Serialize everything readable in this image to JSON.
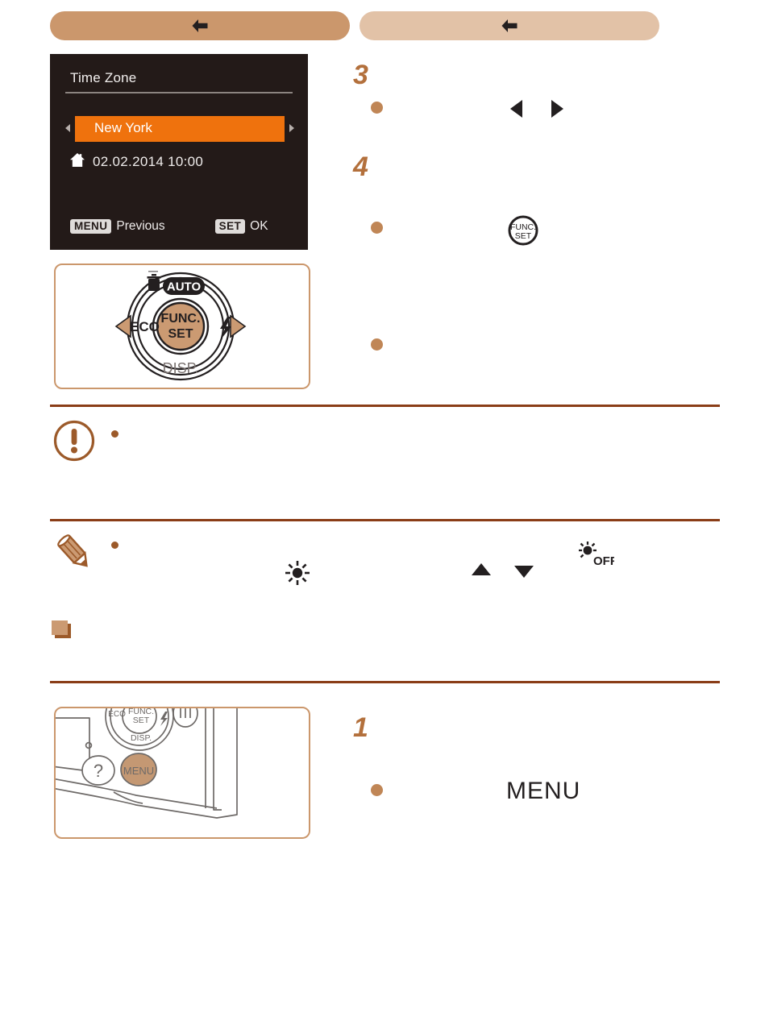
{
  "page": {
    "background": "#ffffff",
    "accent_brown": "#8a3d17",
    "accent_tan": "#cb976c",
    "orange_highlight": "#ef720d",
    "step_number_color": "#b3703c",
    "bullet_color": "#c08656"
  },
  "nav": {
    "prev": {
      "icon": "back-arrow-icon",
      "label": "",
      "color": "#cb976c"
    },
    "next": {
      "icon": "back-arrow-icon",
      "label": "",
      "color": "#e2c2a7"
    }
  },
  "lcd": {
    "title": "Time Zone",
    "timezone": {
      "city": "New York",
      "left_arrow": "triangle-left-icon",
      "right_arrow": "triangle-right-icon"
    },
    "home": {
      "icon": "home-icon",
      "datetime": "02.02.2014 10:00"
    },
    "footer": {
      "menu_badge": "MENU",
      "menu_label": "Previous",
      "set_badge": "SET",
      "set_label": "OK"
    }
  },
  "dial": {
    "top_mode": "AUTO",
    "top_trash": "trash-icon",
    "left_label": "ECO",
    "right_icon": "flash-icon",
    "bottom_label": "DISP.",
    "center_line1": "FUNC.",
    "center_line2": "SET"
  },
  "camera_back": {
    "dial_eco": "ECO",
    "dial_func": "FUNC.",
    "dial_set": "SET",
    "dial_disp": "DISP.",
    "flash_icon": "flash-icon",
    "help_button": "?",
    "menu_button": "MENU",
    "wifi_icon": "wifi-icon"
  },
  "steps": {
    "step3": {
      "number": "3",
      "bullet": "bullet-icon",
      "arrow_left": "triangle-left-icon",
      "arrow_right": "triangle-right-icon"
    },
    "step4": {
      "number": "4",
      "bullet_top": "bullet-icon",
      "func_set_icon": "func-set-button-icon",
      "func_set_line1": "FUNC.",
      "func_set_line2": "SET",
      "bullet_bottom": "bullet-icon"
    },
    "step1": {
      "number": "1",
      "bullet": "bullet-icon",
      "menu_text": "MENU"
    }
  },
  "notices": {
    "warning": {
      "icon": "warning-circle-icon",
      "bullet": "bullet-small-icon"
    },
    "note": {
      "icon": "pencil-icon",
      "bullet": "bullet-small-icon",
      "sun_icon": "eco-sun-icon",
      "up_arrow": "triangle-up-icon",
      "down_arrow": "triangle-down-icon",
      "sun_off_icon": "eco-sun-off-icon",
      "sun_off_label": "OFF"
    }
  },
  "section_marker": {
    "icon": "section-square-icon"
  }
}
